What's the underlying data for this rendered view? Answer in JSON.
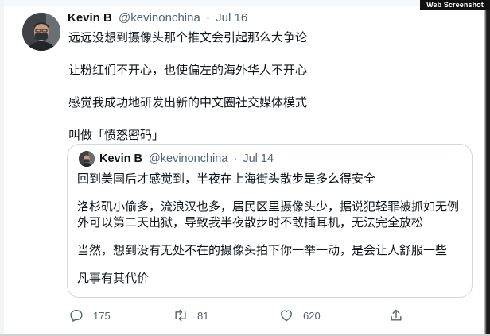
{
  "watermark": "Web Screenshot",
  "tweet": {
    "author_name": "Kevin B",
    "handle": "@kevinonchina",
    "separator": "·",
    "date": "Jul 16",
    "paragraphs": [
      "远远没想到摄像头那个推文会引起那么大争论",
      "让粉红们不开心，也使偏左的海外华人不开心",
      "感觉我成功地研发出新的中文圈社交媒体模式",
      "叫做「愤怒密码」"
    ]
  },
  "quoted_tweet": {
    "author_name": "Kevin B",
    "handle": "@kevinonchina",
    "separator": "·",
    "date": "Jul 14",
    "paragraphs": [
      "回到美国后才感觉到，半夜在上海街头散步是多么得安全",
      "洛杉矶小偷多，流浪汉也多，居民区里摄像头少，据说犯轻罪被抓如无例外可以第二天出狱，导致我半夜散步时不敢插耳机，无法完全放松",
      "当然，想到没有无处不在的摄像头拍下你一举一动，是会让人舒服一些",
      "凡事有其代价"
    ]
  },
  "actions": {
    "reply": {
      "icon": "reply-icon",
      "count": "175"
    },
    "retweet": {
      "icon": "retweet-icon",
      "count": "81"
    },
    "like": {
      "icon": "heart-icon",
      "count": "620"
    },
    "share": {
      "icon": "share-icon"
    }
  },
  "colors": {
    "text": "#0f1419",
    "secondary": "#536471",
    "border": "#cfd9de"
  }
}
